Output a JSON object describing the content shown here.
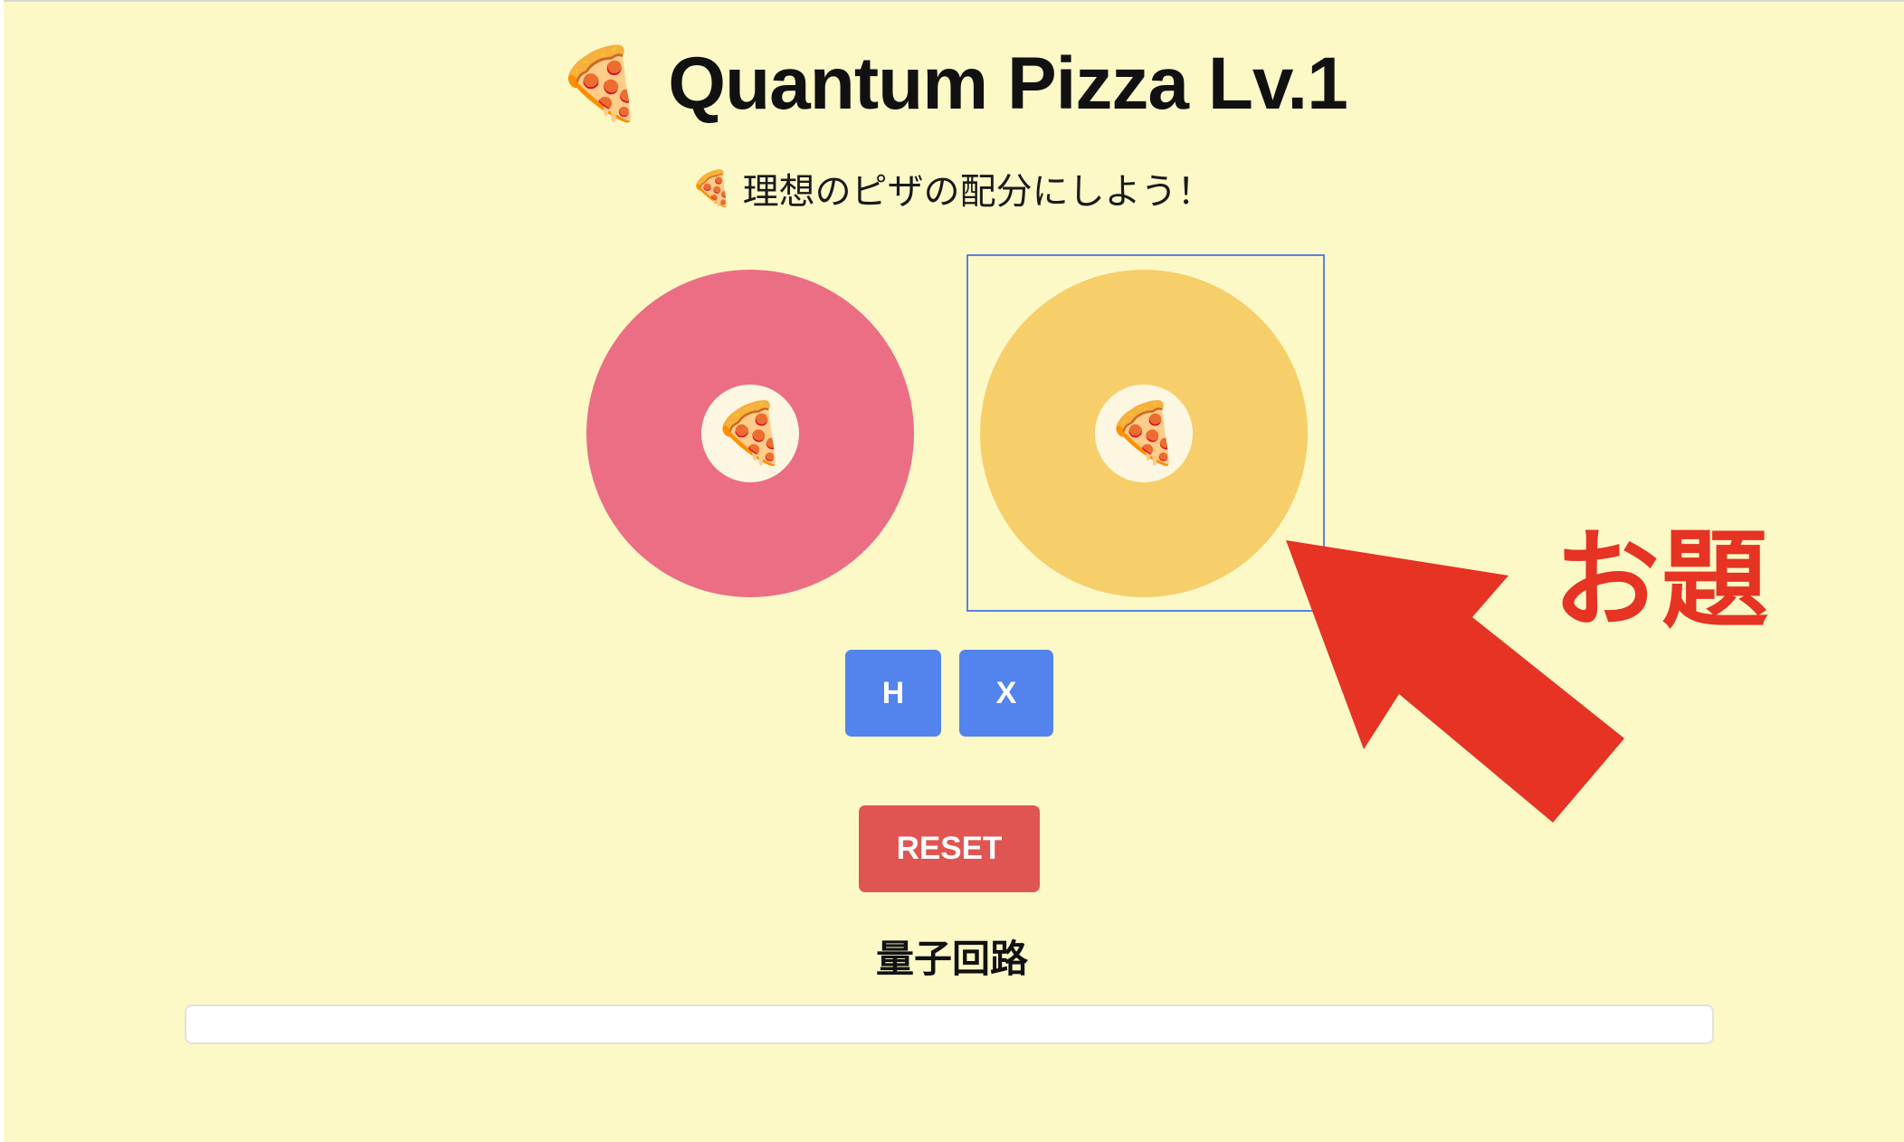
{
  "header": {
    "title_icon": "pizza-icon",
    "title_emoji": "🍕",
    "title": "Quantum Pizza Lv.1",
    "subtitle_icon": "pizza-icon",
    "subtitle_emoji": "🍕",
    "subtitle": "理想のピザの配分にしよう！"
  },
  "pizzas": {
    "current": {
      "color": "#ec6e85",
      "center_emoji": "🍕",
      "icon": "pizza-icon"
    },
    "target": {
      "color": "#f6cf6b",
      "center_emoji": "🍕",
      "icon": "pizza-icon",
      "frame_color": "#5b82e0"
    }
  },
  "gates": {
    "h_label": "H",
    "x_label": "X",
    "color": "#5384ee"
  },
  "reset": {
    "label": "RESET",
    "color": "#e05552"
  },
  "circuit": {
    "title": "量子回路"
  },
  "annotation": {
    "label": "お題",
    "color": "#e63323",
    "icon": "arrow-up-left-icon"
  },
  "theme": {
    "background": "#fdf9c7"
  }
}
